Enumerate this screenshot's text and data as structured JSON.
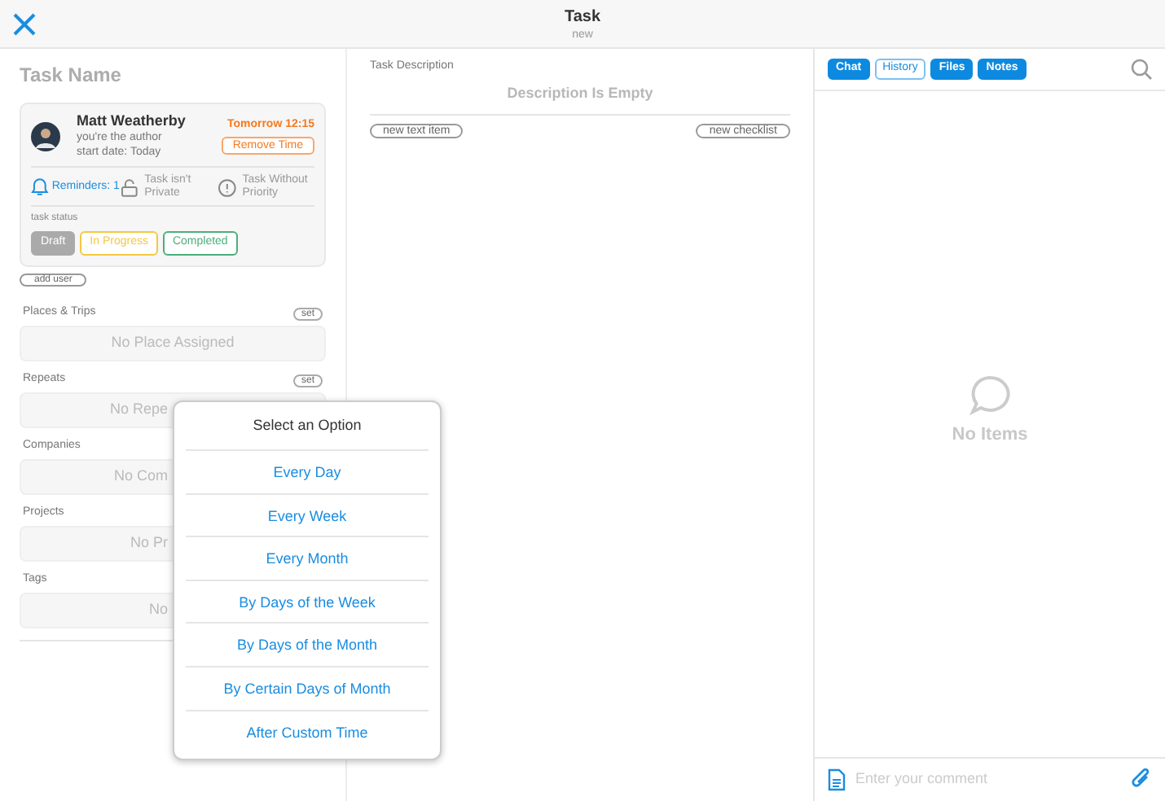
{
  "header": {
    "title": "Task",
    "subtitle": "new"
  },
  "task_name": {
    "placeholder": "Task Name"
  },
  "author_card": {
    "name": "Matt Weatherby",
    "role": "you're the author",
    "start_date": "start date: Today",
    "due": "Tomorrow 12:15",
    "remove_time": "Remove Time",
    "reminders": "Reminders: 1",
    "privacy": "Task isn't Private",
    "priority": "Task Without Priority",
    "status_label": "task status",
    "statuses": [
      {
        "label": "Draft",
        "selected": true,
        "color": "#aaaaaa"
      },
      {
        "label": "In Progress",
        "selected": false,
        "color": "#f5c842"
      },
      {
        "label": "Completed",
        "selected": false,
        "color": "#4caf7a"
      }
    ]
  },
  "add_user": "add user",
  "sections": [
    {
      "title": "Places & Trips",
      "set": "set",
      "value": "No Place Assigned"
    },
    {
      "title": "Repeats",
      "set": "set",
      "value": "No Repe"
    },
    {
      "title": "Companies",
      "value": "No Com"
    },
    {
      "title": "Projects",
      "value": "No Pr"
    },
    {
      "title": "Tags",
      "value": "No"
    }
  ],
  "description": {
    "label": "Task Description",
    "placeholder": "Description Is Empty",
    "new_text_item": "new text item",
    "new_checklist": "new checklist"
  },
  "popup": {
    "title": "Select an Option",
    "options": [
      "Every Day",
      "Every Week",
      "Every Month",
      "By Days of the Week",
      "By Days of the Month",
      "By Certain Days of Month",
      "After Custom Time"
    ]
  },
  "right_tabs": [
    {
      "label": "Chat",
      "selected": false
    },
    {
      "label": "History",
      "selected": true
    },
    {
      "label": "Files",
      "selected": false
    },
    {
      "label": "Notes",
      "selected": false
    }
  ],
  "empty_state": "No Items",
  "comment": {
    "placeholder": "Enter your comment"
  }
}
